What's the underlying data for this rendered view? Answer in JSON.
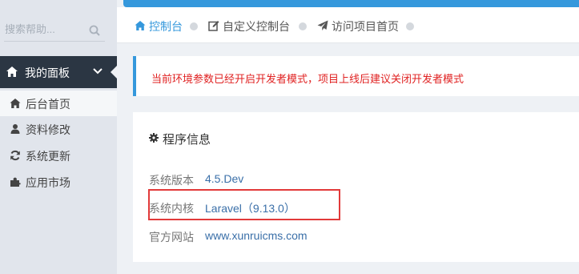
{
  "search": {
    "placeholder": "搜索帮助..."
  },
  "sidebar": {
    "menu_head": {
      "label": "我的面板",
      "icon": "home-icon"
    },
    "items": [
      {
        "label": "后台首页",
        "icon": "home-icon",
        "active": true
      },
      {
        "label": "资料修改",
        "icon": "user-icon",
        "active": false
      },
      {
        "label": "系统更新",
        "icon": "refresh-icon",
        "active": false
      },
      {
        "label": "应用市场",
        "icon": "puzzle-icon",
        "active": false
      }
    ]
  },
  "breadcrumb": {
    "items": [
      {
        "label": "控制台",
        "icon": "home-icon",
        "color": "#3598dc"
      },
      {
        "label": "自定义控制台",
        "icon": "edit-icon",
        "color": "#555555"
      },
      {
        "label": "访问项目首页",
        "icon": "send-icon",
        "color": "#555555"
      }
    ]
  },
  "notice": {
    "text": "当前环境参数已经开启开发者模式，项目上线后建议关闭开发者模式"
  },
  "info": {
    "title": "程序信息",
    "rows": [
      {
        "label": "系统版本",
        "value": "4.5.Dev"
      },
      {
        "label": "系统内核",
        "value": "Laravel（9.13.0）"
      },
      {
        "label": "官方网站",
        "value": "www.xunruicms.com"
      }
    ]
  },
  "colors": {
    "accent": "#3598dc",
    "sidebar_dark": "#2b3643",
    "notice_text": "#e02222",
    "highlight": "#e23a3a"
  }
}
